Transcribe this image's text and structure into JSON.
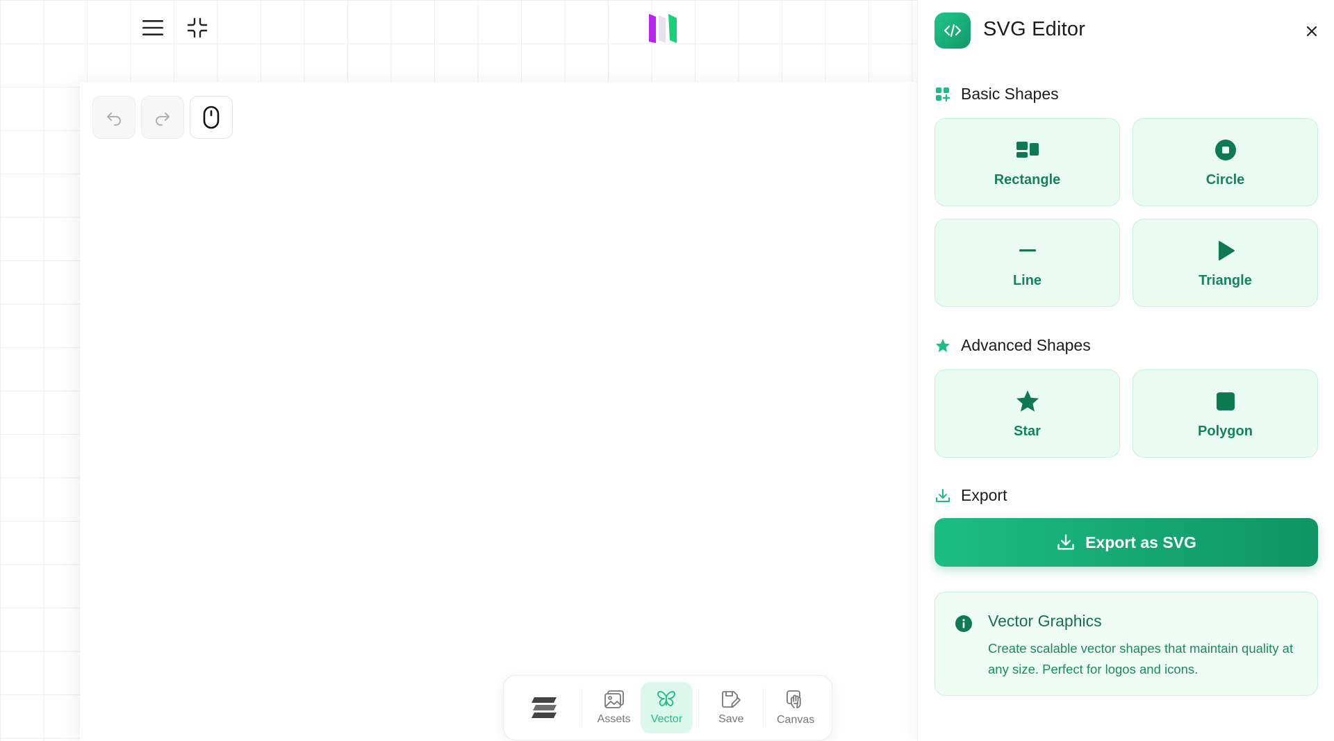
{
  "colors": {
    "accent": "#1bbd84",
    "accent_dark": "#0f9564",
    "card_bg": "#eafbf2",
    "card_border": "#c9f0dc",
    "card_text": "#14855a",
    "logo_purple": "#b622f0",
    "logo_green": "#18d07a"
  },
  "topbar": {
    "menu_icon": "hamburger-menu-icon",
    "collapse_icon": "collapse-icon",
    "logo": "app-logo"
  },
  "canvas": {
    "tools": [
      {
        "name": "undo-icon"
      },
      {
        "name": "redo-icon"
      },
      {
        "name": "mouse-icon"
      }
    ]
  },
  "dock": {
    "items": [
      {
        "label": "",
        "icon": "stack-logo-icon"
      },
      {
        "label": "Assets",
        "icon": "image-icon"
      },
      {
        "label": "Vector",
        "icon": "butterfly-icon",
        "active": true
      },
      {
        "label": "Save",
        "icon": "save-icon"
      },
      {
        "label": "Canvas",
        "icon": "hand-icon"
      }
    ]
  },
  "panel": {
    "title": "SVG Editor",
    "close_icon": "close-icon",
    "basic": {
      "title": "Basic Shapes",
      "shapes": [
        {
          "label": "Rectangle",
          "icon": "rectangle-icon"
        },
        {
          "label": "Circle",
          "icon": "circle-icon"
        },
        {
          "label": "Line",
          "icon": "line-icon"
        },
        {
          "label": "Triangle",
          "icon": "triangle-icon"
        }
      ]
    },
    "advanced": {
      "title": "Advanced Shapes",
      "shapes": [
        {
          "label": "Star",
          "icon": "star-icon"
        },
        {
          "label": "Polygon",
          "icon": "polygon-icon"
        }
      ]
    },
    "export": {
      "title": "Export",
      "button_label": "Export as SVG"
    },
    "info": {
      "title": "Vector Graphics",
      "text": "Create scalable vector shapes that maintain quality at any size. Perfect for logos and icons."
    }
  }
}
